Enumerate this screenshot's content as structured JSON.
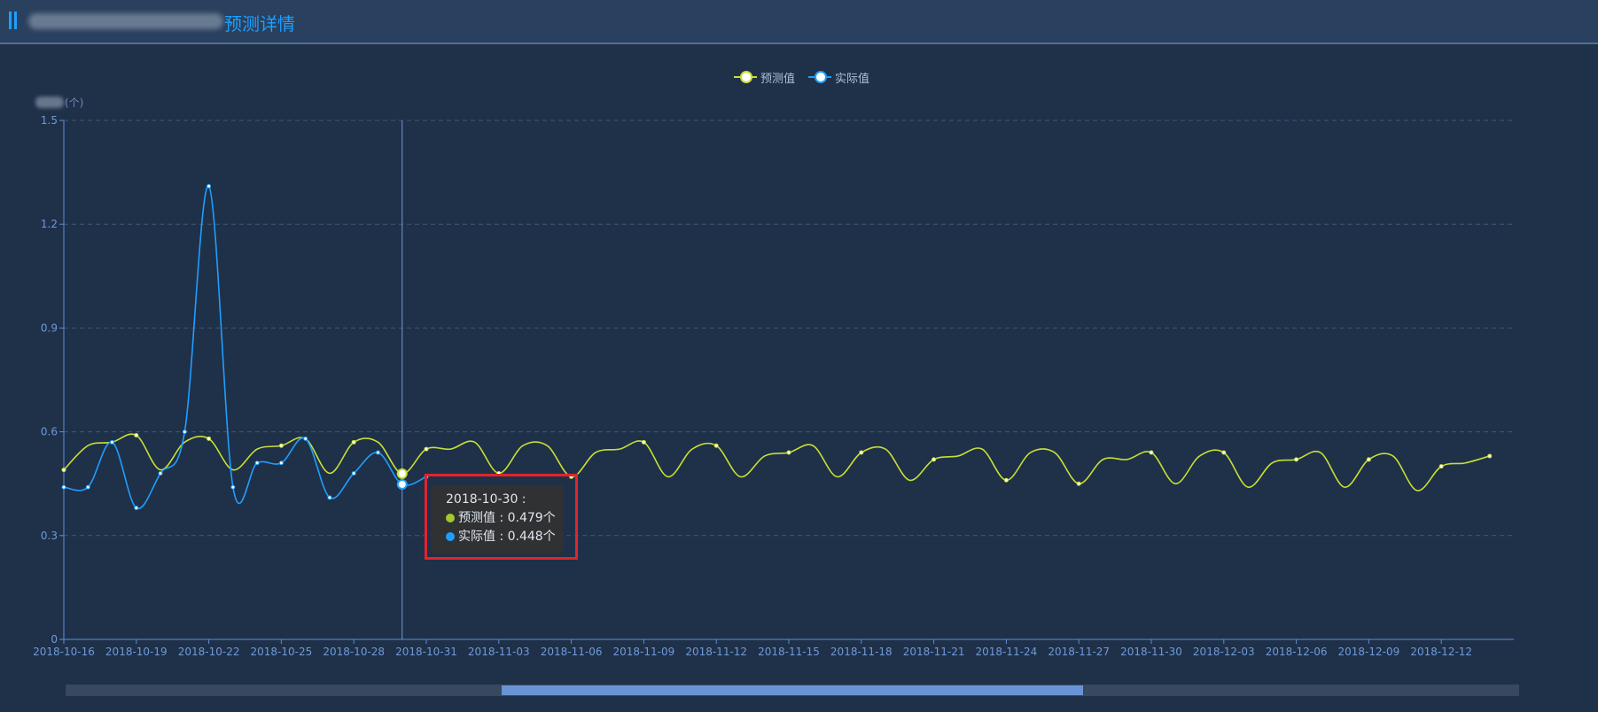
{
  "header": {
    "title_suffix": "预测详情"
  },
  "legend": [
    {
      "label": "预测值",
      "color": "#c7e034"
    },
    {
      "label": "实际值",
      "color": "#1e9fff"
    }
  ],
  "y_axis_unit": "(个)",
  "tooltip": {
    "date": "2018-10-30 :",
    "rows": [
      {
        "text": "预测值 : 0.479个",
        "color": "#a5c82c"
      },
      {
        "text": "实际值 : 0.448个",
        "color": "#1e9fff"
      }
    ]
  },
  "slider": {
    "start_fraction": 0.3,
    "end_fraction": 0.7
  },
  "chart_data": {
    "type": "line",
    "ylabel": "(个)",
    "ylim": [
      0,
      1.5
    ],
    "yticks": [
      0,
      0.3,
      0.6,
      0.9,
      1.2,
      1.5
    ],
    "x_start": "2018-10-16",
    "x_end": "2018-12-15",
    "tick_labels": [
      "2018-10-16",
      "2018-10-19",
      "2018-10-22",
      "2018-10-25",
      "2018-10-28",
      "2018-10-31",
      "2018-11-03",
      "2018-11-06",
      "2018-11-09",
      "2018-11-12",
      "2018-11-15",
      "2018-11-18",
      "2018-11-21",
      "2018-11-24",
      "2018-11-27",
      "2018-11-30",
      "2018-12-03",
      "2018-12-06",
      "2018-12-09",
      "2018-12-12"
    ],
    "grid": "dashed horizontal",
    "legend_position": "top-center",
    "hover_date": "2018-10-30",
    "series": [
      {
        "name": "预测值",
        "color": "#c7e034",
        "values": [
          0.49,
          0.56,
          0.57,
          0.59,
          0.49,
          0.57,
          0.58,
          0.49,
          0.55,
          0.56,
          0.58,
          0.48,
          0.57,
          0.57,
          0.479,
          0.55,
          0.55,
          0.57,
          0.48,
          0.56,
          0.56,
          0.47,
          0.54,
          0.55,
          0.57,
          0.47,
          0.55,
          0.56,
          0.47,
          0.53,
          0.54,
          0.56,
          0.47,
          0.54,
          0.55,
          0.46,
          0.52,
          0.53,
          0.55,
          0.46,
          0.54,
          0.54,
          0.45,
          0.52,
          0.52,
          0.54,
          0.45,
          0.53,
          0.54,
          0.44,
          0.51,
          0.52,
          0.54,
          0.44,
          0.52,
          0.53,
          0.43,
          0.5,
          0.51,
          0.53
        ]
      },
      {
        "name": "实际值",
        "color": "#1e9fff",
        "values": [
          0.44,
          0.44,
          0.57,
          0.38,
          0.48,
          0.6,
          1.31,
          0.44,
          0.51,
          0.51,
          0.58,
          0.41,
          0.48,
          0.54,
          0.448,
          0.47
        ]
      }
    ]
  }
}
